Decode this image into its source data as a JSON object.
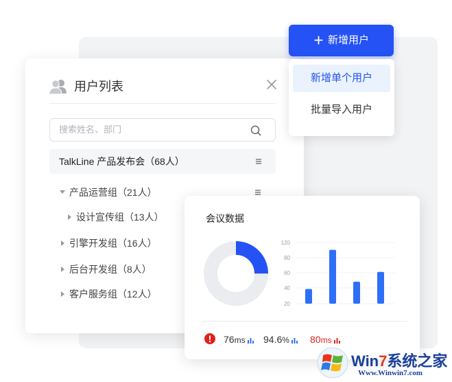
{
  "user_list": {
    "title": "用户列表",
    "search_placeholder": "搜索姓名、部门",
    "root": {
      "label": "TalkLine 产品发布会（68人）"
    },
    "groups": [
      {
        "label": "产品运营组（21人）",
        "expanded": true
      },
      {
        "label": "设计宣传组（13人）",
        "expanded": false
      },
      {
        "label": "引擎开发组（16人）",
        "expanded": false
      },
      {
        "label": "后台开发组（8人）",
        "expanded": false
      },
      {
        "label": "客户服务组（12人）",
        "expanded": false
      }
    ]
  },
  "add_user": {
    "label": "新增用户",
    "menu": [
      {
        "label": "新增单个用户",
        "active": true
      },
      {
        "label": "批量导入用户",
        "active": false
      }
    ]
  },
  "meeting": {
    "title": "会议数据",
    "stats": [
      {
        "value": "76",
        "unit": "ms",
        "color": "#333333"
      },
      {
        "value": "94.6",
        "unit": "%",
        "color": "#333333"
      },
      {
        "value": "80",
        "unit": "ms",
        "color": "#e0201b"
      }
    ]
  },
  "chart_data": [
    {
      "type": "pie",
      "variant": "donut",
      "values": [
        25,
        75
      ],
      "colors": [
        "#2452f5",
        "#ebecf0"
      ]
    },
    {
      "type": "bar",
      "categories": [
        "",
        "",
        "",
        "",
        "",
        ""
      ],
      "values": [
        44,
        108,
        56,
        72
      ],
      "yticks": [
        "120",
        "80",
        "60",
        "40",
        "20"
      ],
      "ylim": [
        20,
        120
      ],
      "grid": true,
      "color": "#2d6ff7"
    }
  ],
  "watermark": {
    "title_main": "Win",
    "title_seven": "7",
    "title_rest": "系统之家",
    "url": "Www.Winwin7.com"
  },
  "colors": {
    "accent": "#2452f5",
    "active_bg": "#eaf2fd",
    "danger": "#e0201b"
  }
}
